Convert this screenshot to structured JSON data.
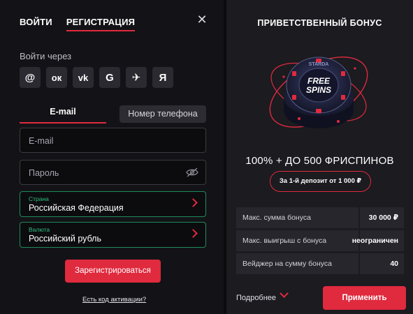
{
  "auth": {
    "tabs": [
      "ВОЙТИ",
      "РЕГИСТРАЦИЯ"
    ],
    "close_icon": "close-icon",
    "login_via_label": "Войти через",
    "socials": [
      {
        "name": "email",
        "icon": "at-sign-icon",
        "glyph": "@"
      },
      {
        "name": "odnoklassniki",
        "icon": "ok-icon",
        "glyph": "ок"
      },
      {
        "name": "vk",
        "icon": "vk-icon",
        "glyph": "vk"
      },
      {
        "name": "google",
        "icon": "google-icon",
        "glyph": "G"
      },
      {
        "name": "telegram",
        "icon": "telegram-icon",
        "glyph": "✈"
      },
      {
        "name": "yandex",
        "icon": "yandex-icon",
        "glyph": "Я"
      }
    ],
    "modes": {
      "email": "E-mail",
      "phone": "Номер телефона"
    },
    "email_placeholder": "E-mail",
    "password_placeholder": "Пароль",
    "country_label": "Страна",
    "country_value": "Российская Федерация",
    "currency_label": "Валюта",
    "currency_value": "Российский рубль",
    "register_button": "Зарегистрироваться",
    "activation_link": "Есть код активации?"
  },
  "bonus": {
    "title": "ПРИВЕТСТВЕННЫЙ БОНУС",
    "chip_text": {
      "line1": "FREE",
      "line2": "SPINS",
      "ring": "STARDA"
    },
    "amount": "100% + ДО 500 ФРИСПИНОВ",
    "deposit_badge": "За 1-й депозит от 1 000 ₽",
    "details": [
      {
        "label": "Макс. сумма бонуса",
        "value": "30 000 ₽"
      },
      {
        "label": "Макс. выигрыш с бонуса",
        "value": "неограничен"
      },
      {
        "label": "Вейджер на сумму бонуса",
        "value": "40"
      }
    ],
    "more_label": "Подробнее",
    "apply_button": "Применить"
  },
  "colors": {
    "accent": "#e02a3e",
    "valid": "#2fbf7f",
    "panel": "#131317",
    "panel_right": "#1b1b20"
  }
}
